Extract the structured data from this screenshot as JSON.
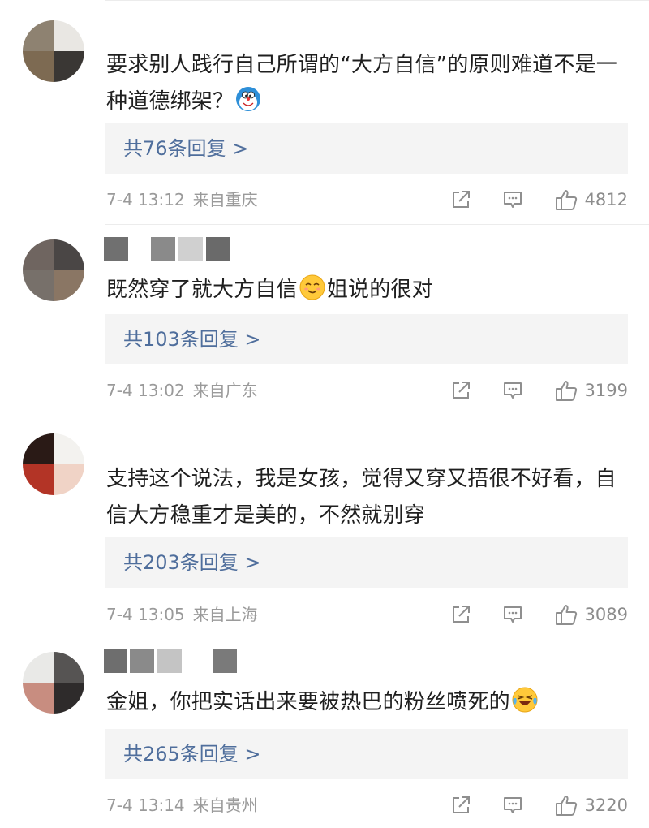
{
  "comments": [
    {
      "text": "要求别人践行自己所谓的“大方自信”的原则难道不是一种道德绑架？",
      "emoji": "doraemon-emoji",
      "replies": "共76条回复 >",
      "time": "7-4 13:12",
      "location": "来自重庆",
      "likes": "4812"
    },
    {
      "text_before": "既然穿了就大方自信",
      "emoji": "smile-emoji",
      "text_after": "姐说的很对",
      "replies": "共103条回复 >",
      "time": "7-4 13:02",
      "location": "来自广东",
      "likes": "3199"
    },
    {
      "text": "支持这个说法，我是女孩，觉得又穿又捂很不好看，自信大方稳重才是美的，不然就别穿",
      "replies": "共203条回复 >",
      "time": "7-4 13:05",
      "location": "来自上海",
      "likes": "3089"
    },
    {
      "text": "金姐，你把实话出来要被热巴的粉丝喷死的",
      "emoji": "laugh-cry-emoji",
      "replies": "共265条回复 >",
      "time": "7-4 13:14",
      "location": "来自贵州",
      "likes": "3220"
    }
  ],
  "colors": {
    "reply_link": "#4f6e9c",
    "meta_gray": "#9a9a9a",
    "reply_bg": "#f4f4f4"
  },
  "icons": {
    "share": "share-icon",
    "comment": "comment-icon",
    "like": "thumbs-up-icon"
  }
}
